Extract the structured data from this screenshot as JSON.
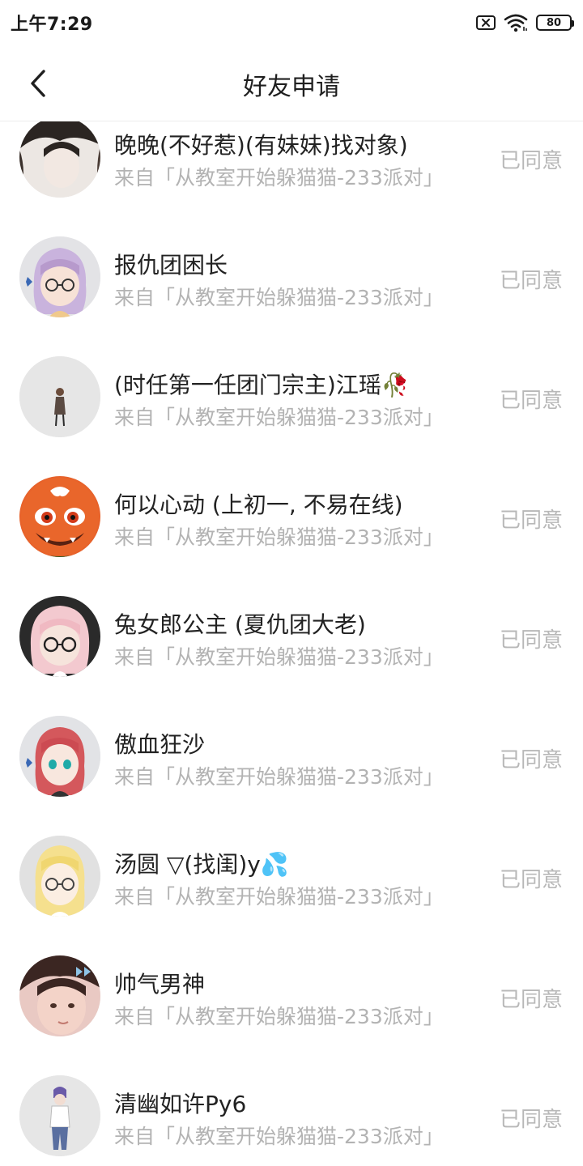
{
  "status_bar": {
    "time": "上午7:29",
    "battery": "80",
    "icons": [
      "sim-off-icon",
      "wifi-icon",
      "battery-icon"
    ]
  },
  "nav": {
    "back_icon": "chevron-left-icon",
    "title": "好友申请"
  },
  "requests": [
    {
      "name": "晚晚(不好惹)(有妹妹)找对象)",
      "source": "来自「从教室开始躲猫猫-233派对」",
      "status": "已同意"
    },
    {
      "name": "报仇团困长",
      "source": "来自「从教室开始躲猫猫-233派对」",
      "status": "已同意"
    },
    {
      "name": "(时任第一任团门宗主)江瑶🥀",
      "source": "来自「从教室开始躲猫猫-233派对」",
      "status": "已同意"
    },
    {
      "name": "何以心动 (上初一, 不易在线)",
      "source": "来自「从教室开始躲猫猫-233派对」",
      "status": "已同意"
    },
    {
      "name": "兔女郎公主 (夏仇团大老)",
      "source": "来自「从教室开始躲猫猫-233派对」",
      "status": "已同意"
    },
    {
      "name": "傲血狂沙",
      "source": "来自「从教室开始躲猫猫-233派对」",
      "status": "已同意"
    },
    {
      "name": "汤圆 ▽(找闺)y💦",
      "source": "来自「从教室开始躲猫猫-233派对」",
      "status": "已同意"
    },
    {
      "name": "帅气男神",
      "source": "来自「从教室开始躲猫猫-233派对」",
      "status": "已同意"
    },
    {
      "name": "清幽如许Py6",
      "source": "来自「从教室开始躲猫猫-233派对」",
      "status": "已同意"
    }
  ],
  "colors": {
    "name_text": "#222222",
    "source_text": "#b3b3b3",
    "status_text": "#b8b8b8",
    "divider": "#ececec"
  }
}
